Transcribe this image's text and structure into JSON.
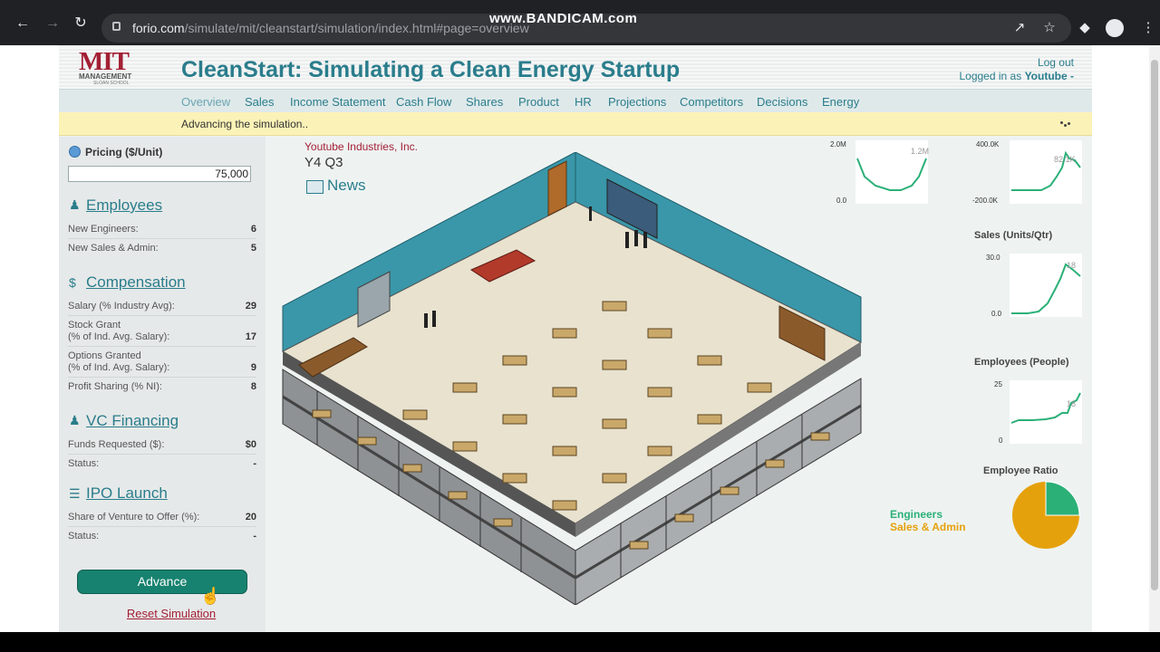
{
  "browser": {
    "url_host": "forio.com",
    "url_path": "/simulate/mit/cleanstart/simulation/index.html#page=overview",
    "watermark": "www.BANDICAM.com"
  },
  "header": {
    "logo_text": "MIT",
    "logo_sub1": "MANAGEMENT",
    "logo_sub2": "SLOAN SCHOOL",
    "title": "CleanStart: Simulating a Clean Energy Startup",
    "logout": "Log out",
    "logged_in_prefix": "Logged in as",
    "logged_in_user": "Youtube -"
  },
  "nav": {
    "items": [
      "Overview",
      "Sales",
      "Income Statement",
      "Cash Flow",
      "Shares",
      "Product",
      "HR",
      "Projections",
      "Competitors",
      "Decisions",
      "Energy"
    ],
    "active": "Overview"
  },
  "status": {
    "text": "Advancing the simulation.."
  },
  "decisions": {
    "pricing_label": "Pricing ($/Unit)",
    "pricing_value": "75,000",
    "employees": {
      "heading": "Employees",
      "rows": [
        {
          "label": "New Engineers:",
          "value": "6"
        },
        {
          "label": "New Sales & Admin:",
          "value": "5"
        }
      ]
    },
    "compensation": {
      "heading": "Compensation",
      "rows": [
        {
          "label": "Salary (% Industry Avg):",
          "value": "29"
        },
        {
          "label": "Stock Grant",
          "label2": "(% of Ind. Avg. Salary):",
          "value": "17"
        },
        {
          "label": "Options Granted",
          "label2": "(% of Ind. Avg. Salary):",
          "value": "9"
        },
        {
          "label": "Profit Sharing (% NI):",
          "value": "8"
        }
      ]
    },
    "vc": {
      "heading": "VC Financing",
      "rows": [
        {
          "label": "Funds Requested ($):",
          "value": "$0"
        },
        {
          "label": "Status:",
          "value": "-"
        }
      ]
    },
    "ipo": {
      "heading": "IPO Launch",
      "rows": [
        {
          "label": "Share of Venture to Offer (%):",
          "value": "20"
        },
        {
          "label": "Status:",
          "value": "-"
        }
      ]
    },
    "advance_label": "Advance",
    "reset_label": "Reset Simulation"
  },
  "overview": {
    "company": "Youtube Industries, Inc.",
    "period": "Y4 Q3",
    "news_label": "News"
  },
  "mini_charts": {
    "chart1": {
      "top": "2.0M",
      "bottom": "0.0",
      "end_label": "1.2M"
    },
    "chart2": {
      "top": "400.0K",
      "bottom": "-200.0K",
      "end_label": "82.1K"
    },
    "sales": {
      "title": "Sales (Units/Qtr)",
      "top": "30.0",
      "bottom": "0.0",
      "end_label": "18"
    },
    "employees": {
      "title": "Employees (People)",
      "top": "25",
      "bottom": "0",
      "end_label": "18"
    },
    "ratio": {
      "title": "Employee Ratio",
      "legend_engineers": "Engineers",
      "legend_sales": "Sales & Admin",
      "engineers_fraction": 0.25
    }
  },
  "colors": {
    "accent": "#2a7d8c",
    "mit_red": "#a31f34",
    "advance_green": "#17826f",
    "engineers": "#2bb077",
    "sales_admin": "#e5a10c"
  }
}
